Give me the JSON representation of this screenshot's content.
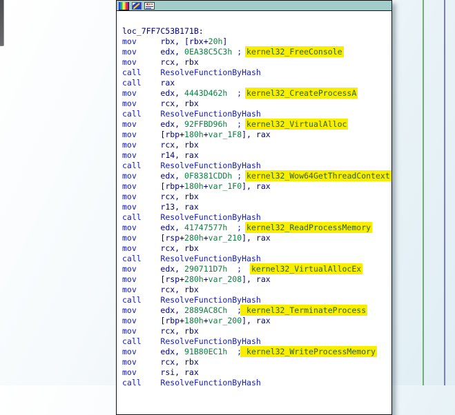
{
  "view": {
    "kind": "disassembly-graph-node",
    "label": "loc_7FF7C53B171B:",
    "icons": [
      "node-color-icon",
      "edit-node-icon",
      "sync-node-icon"
    ],
    "colors": {
      "titlebar": "#a3cdcb",
      "node_bg": "#ffffff",
      "node_border": "#101010",
      "highlight_bg": "#f8ef00",
      "highlight_text": "#355f12",
      "mnemonic_blue": "#1018c8",
      "operand_navy": "#00007f",
      "number_green": "#0a7f3f",
      "edge_green": "#70ad70",
      "edge_blue": "#797bd0"
    },
    "lines": [
      [
        [
          "lbl",
          "loc_7FF7C53B171B:"
        ]
      ],
      [
        [
          "mn",
          "mov     "
        ],
        [
          "op",
          "rbx, [rbx+"
        ],
        [
          "num",
          "20h"
        ],
        [
          "op",
          "]"
        ]
      ],
      [
        [
          "mn",
          "mov     "
        ],
        [
          "op",
          "edx, "
        ],
        [
          "num",
          "0EA38C5C3h"
        ],
        [
          "cmt",
          " ; "
        ],
        [
          "hl",
          "kernel32_FreeConsole"
        ]
      ],
      [
        [
          "mn",
          "mov     "
        ],
        [
          "op",
          "rcx, rbx"
        ]
      ],
      [
        [
          "mn",
          "call    "
        ],
        [
          "fn",
          "ResolveFunctionByHash"
        ]
      ],
      [
        [
          "mn",
          "call    "
        ],
        [
          "op",
          "rax"
        ]
      ],
      [
        [
          "mn",
          "mov     "
        ],
        [
          "op",
          "edx, "
        ],
        [
          "num",
          "4443D462h"
        ],
        [
          "cmt",
          "  ; "
        ],
        [
          "hl",
          "kernel32_CreateProcessA"
        ]
      ],
      [
        [
          "mn",
          "mov     "
        ],
        [
          "op",
          "rcx, rbx"
        ]
      ],
      [
        [
          "mn",
          "call    "
        ],
        [
          "fn",
          "ResolveFunctionByHash"
        ]
      ],
      [
        [
          "mn",
          "mov     "
        ],
        [
          "op",
          "edx, "
        ],
        [
          "num",
          "92FFBD96h"
        ],
        [
          "cmt",
          "  ; "
        ],
        [
          "hl",
          "kernel32_VirtualAlloc"
        ]
      ],
      [
        [
          "mn",
          "mov     "
        ],
        [
          "op",
          "[rbp+"
        ],
        [
          "num",
          "180h"
        ],
        [
          "op",
          "+"
        ],
        [
          "num",
          "var_1F8"
        ],
        [
          "op",
          "], rax"
        ]
      ],
      [
        [
          "mn",
          "mov     "
        ],
        [
          "op",
          "rcx, rbx"
        ]
      ],
      [
        [
          "mn",
          "mov     "
        ],
        [
          "op",
          "r14, rax"
        ]
      ],
      [
        [
          "mn",
          "call    "
        ],
        [
          "fn",
          "ResolveFunctionByHash"
        ]
      ],
      [
        [
          "mn",
          "mov     "
        ],
        [
          "op",
          "edx, "
        ],
        [
          "num",
          "0F8381CDDh"
        ],
        [
          "cmt",
          " ; "
        ],
        [
          "hl",
          "kernel32_Wow64GetThreadContext"
        ]
      ],
      [
        [
          "mn",
          "mov     "
        ],
        [
          "op",
          "[rbp+"
        ],
        [
          "num",
          "180h"
        ],
        [
          "op",
          "+"
        ],
        [
          "num",
          "var_1F0"
        ],
        [
          "op",
          "], rax"
        ]
      ],
      [
        [
          "mn",
          "mov     "
        ],
        [
          "op",
          "rcx, rbx"
        ]
      ],
      [
        [
          "mn",
          "mov     "
        ],
        [
          "op",
          "r13, rax"
        ]
      ],
      [
        [
          "mn",
          "call    "
        ],
        [
          "fn",
          "ResolveFunctionByHash"
        ]
      ],
      [
        [
          "mn",
          "mov     "
        ],
        [
          "op",
          "edx, "
        ],
        [
          "num",
          "41747577h"
        ],
        [
          "cmt",
          "  ; "
        ],
        [
          "hl",
          "kernel32_ReadProcessMemory"
        ]
      ],
      [
        [
          "mn",
          "mov     "
        ],
        [
          "op",
          "[rsp+"
        ],
        [
          "num",
          "280h"
        ],
        [
          "op",
          "+"
        ],
        [
          "num",
          "var_210"
        ],
        [
          "op",
          "], rax"
        ]
      ],
      [
        [
          "mn",
          "mov     "
        ],
        [
          "op",
          "rcx, rbx"
        ]
      ],
      [
        [
          "mn",
          "call    "
        ],
        [
          "fn",
          "ResolveFunctionByHash"
        ]
      ],
      [
        [
          "mn",
          "mov     "
        ],
        [
          "op",
          "edx, "
        ],
        [
          "num",
          "290711D7h"
        ],
        [
          "cmt",
          "  ;  "
        ],
        [
          "hl",
          "kernel32_VirtualAllocEx"
        ]
      ],
      [
        [
          "mn",
          "mov     "
        ],
        [
          "op",
          "[rsp+"
        ],
        [
          "num",
          "280h"
        ],
        [
          "op",
          "+"
        ],
        [
          "num",
          "var_208"
        ],
        [
          "op",
          "], rax"
        ]
      ],
      [
        [
          "mn",
          "mov     "
        ],
        [
          "op",
          "rcx, rbx"
        ]
      ],
      [
        [
          "mn",
          "call    "
        ],
        [
          "fn",
          "ResolveFunctionByHash"
        ]
      ],
      [
        [
          "mn",
          "mov     "
        ],
        [
          "op",
          "edx, "
        ],
        [
          "num",
          "2889AC8Ch"
        ],
        [
          "cmt",
          "  ;"
        ],
        [
          "hl",
          " kernel32_TerminateProcess"
        ]
      ],
      [
        [
          "mn",
          "mov     "
        ],
        [
          "op",
          "[rbp+"
        ],
        [
          "num",
          "180h"
        ],
        [
          "op",
          "+"
        ],
        [
          "num",
          "var_200"
        ],
        [
          "op",
          "], rax"
        ]
      ],
      [
        [
          "mn",
          "mov     "
        ],
        [
          "op",
          "rcx, rbx"
        ]
      ],
      [
        [
          "mn",
          "call    "
        ],
        [
          "fn",
          "ResolveFunctionByHash"
        ]
      ],
      [
        [
          "mn",
          "mov     "
        ],
        [
          "op",
          "edx, "
        ],
        [
          "num",
          "91B80EC1h"
        ],
        [
          "cmt",
          "  ;"
        ],
        [
          "hl",
          " kernel32_WriteProcessMemory"
        ]
      ],
      [
        [
          "mn",
          "mov     "
        ],
        [
          "op",
          "rcx, rbx"
        ]
      ],
      [
        [
          "mn",
          "mov     "
        ],
        [
          "op",
          "rsi, rax"
        ]
      ],
      [
        [
          "mn",
          "call    "
        ],
        [
          "fn",
          "ResolveFunctionByHash"
        ]
      ]
    ]
  }
}
